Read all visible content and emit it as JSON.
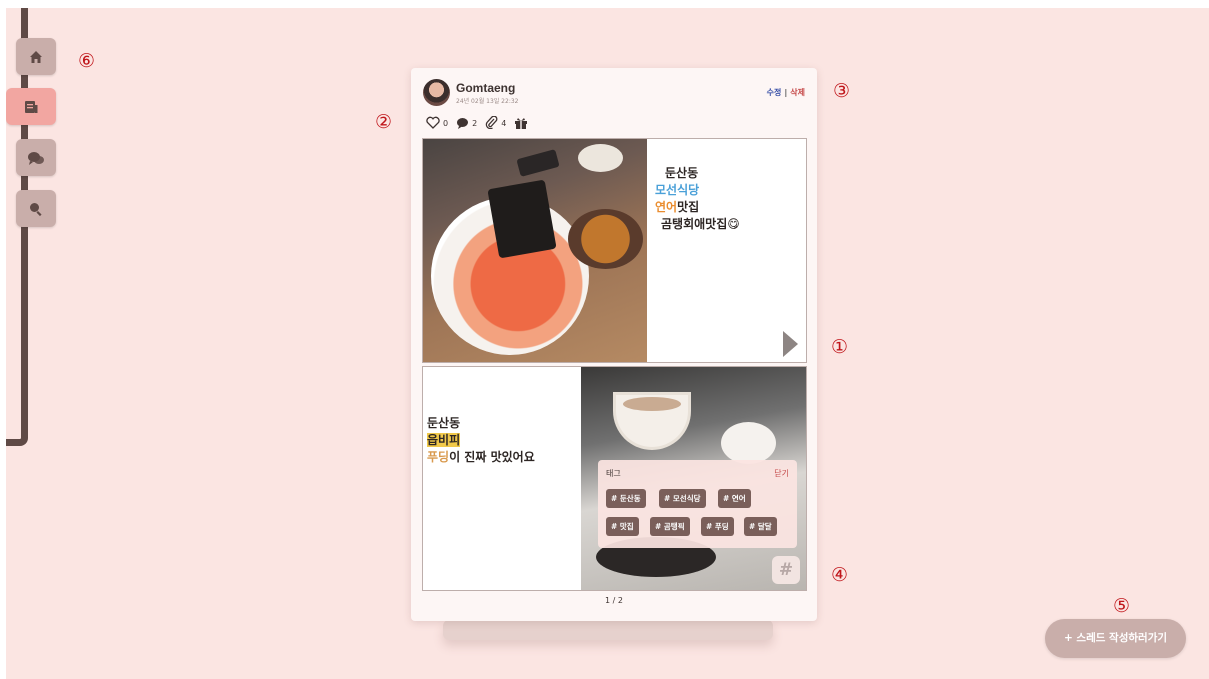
{
  "markers": {
    "m1": "①",
    "m2": "②",
    "m3": "③",
    "m4": "④",
    "m5": "⑤",
    "m6": "⑥"
  },
  "nav": {
    "items": [
      {
        "icon": "home-icon"
      },
      {
        "icon": "posts-icon",
        "active": true
      },
      {
        "icon": "chat-icon"
      },
      {
        "icon": "search-icon"
      }
    ]
  },
  "post": {
    "username": "Gomtaeng",
    "date": "24년 02월 13일 22:32",
    "edit_label": "수정",
    "separator": "|",
    "delete_label": "삭제",
    "likes": "0",
    "comments": "2",
    "attachments": "4",
    "slide1": {
      "l1": "둔산동",
      "l2": "모선식당",
      "l3a": "연어",
      "l3b": "맛집",
      "l4": "곰탱회애맛집😋"
    },
    "slide2": {
      "l1": "둔산동",
      "l2": "읍비피",
      "l3a": "푸딩",
      "l3b": "이 진짜 맛있어요"
    },
    "tags": {
      "title": "태그",
      "close": "닫기",
      "items": [
        "# 둔산동",
        "# 모선식당",
        "# 연어",
        "# 맛집",
        "# 곰탱픽",
        "# 푸딩",
        "# 달달"
      ]
    },
    "hash_symbol": "#",
    "pager": "1 / 2"
  },
  "cta_label": "+ 스레드 작성하러가기",
  "colors": {
    "background": "#fbe5e2",
    "rail": "#5f4a46",
    "accent": "#f2a6a1",
    "tag": "#7a5f5a",
    "marker": "#c0161b"
  }
}
